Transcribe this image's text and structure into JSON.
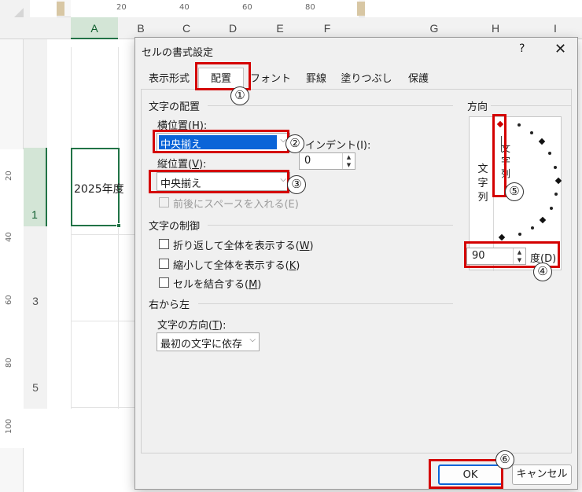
{
  "excel": {
    "columns": [
      "A",
      "B",
      "C",
      "D",
      "E",
      "F",
      "G",
      "H",
      "I"
    ],
    "ruler_h": [
      "20",
      "40",
      "60",
      "80"
    ],
    "ruler_v": [
      "20",
      "40",
      "60",
      "80",
      "100"
    ],
    "rows": [
      "1",
      "3",
      "5"
    ],
    "cell_a1": "2025年度"
  },
  "dialog": {
    "title": "セルの書式設定",
    "help": "?",
    "close": "✕",
    "tabs": [
      "表示形式",
      "配置",
      "フォント",
      "罫線",
      "塗りつぶし",
      "保護"
    ],
    "text_alignment": {
      "heading": "文字の配置",
      "horizontal_label": "横位置(",
      "horizontal_key": "H",
      "horizontal_label_end": "):",
      "horizontal_value": "中央揃え",
      "indent_label": "インデント(I):",
      "indent_value": "0",
      "vertical_label": "縦位置(",
      "vertical_key": "V",
      "vertical_label_end": "):",
      "vertical_value": "中央揃え",
      "justify_distributed": "前後にスペースを入れる(E)"
    },
    "text_control": {
      "heading": "文字の制御",
      "wrap_text": "折り返して全体を表示する(",
      "wrap_key": "W",
      "shrink": "縮小して全体を表示する(",
      "shrink_key": "K",
      "merge": "セルを結合する(",
      "merge_key": "M",
      "close_paren": ")"
    },
    "rtl": {
      "heading": "右から左",
      "direction_label": "文字の方向(",
      "direction_key": "T",
      "direction_end": "):",
      "direction_value": "最初の文字に依存"
    },
    "orientation": {
      "heading": "方向",
      "vertical_text": "文字列",
      "needle_text": "文字列",
      "degrees_value": "90",
      "degrees_label": "度(D)"
    },
    "buttons": {
      "ok": "OK",
      "cancel": "キャンセル"
    }
  },
  "annotations": [
    "①",
    "②",
    "③",
    "④",
    "⑤",
    "⑥"
  ],
  "colors": {
    "highlight_red": "#d40000",
    "selection_blue": "#0a64d8",
    "excel_green": "#217346"
  }
}
